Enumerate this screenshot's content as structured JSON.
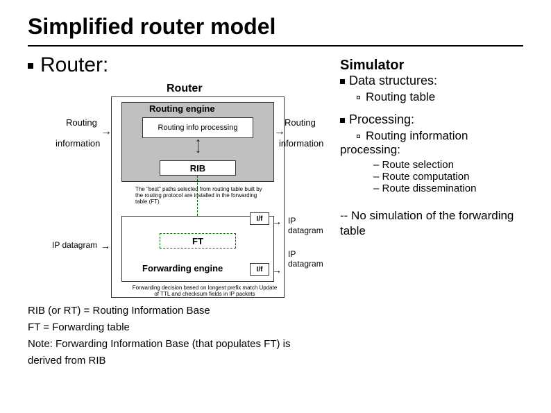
{
  "title": "Simplified router model",
  "left": {
    "heading": "Router:",
    "router_label": "Router",
    "routing_engine": "Routing engine",
    "routing_info_processing": "Routing info processing",
    "rib": "RIB",
    "routing": "Routing",
    "information": "information",
    "note_best_paths": "The \"best\" paths selected from routing table built by the routing protocol are installed in the forwarding  table (FT)",
    "if": "I/f",
    "ft": "FT",
    "forwarding_engine": "Forwarding engine",
    "ip_datagram": "IP datagram",
    "note_forwarding": "Forwarding decision based on longest prefix match Update of TTL and checksum fields in IP packets",
    "footer_rib": "RIB (or RT) = Routing Information Base",
    "footer_ft": "FT = Forwarding table",
    "footer_note": "Note: Forwarding Information Base (that populates FT) is derived from RIB"
  },
  "right": {
    "simulator": "Simulator",
    "data_structures": "Data structures:",
    "routing_table": "Routing table",
    "processing": "Processing:",
    "rip": "Routing information processing:",
    "route_selection": "Route selection",
    "route_computation": "Route computation",
    "route_dissemination": "Route dissemination",
    "no_sim": "-- No simulation of the forwarding table"
  }
}
